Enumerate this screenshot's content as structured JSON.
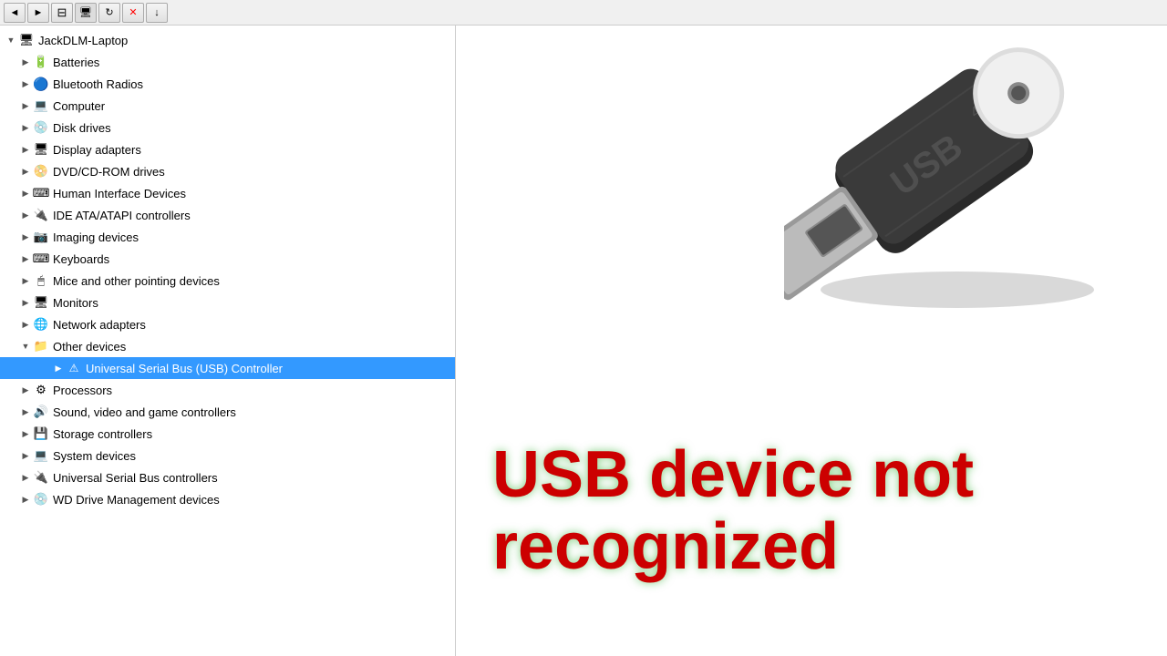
{
  "toolbar": {
    "buttons": [
      "◄",
      "►",
      "⊟",
      "⊞",
      "↑",
      "✕",
      "↓"
    ]
  },
  "tree": {
    "root": "JackDLM-Laptop",
    "items": [
      {
        "id": "batteries",
        "label": "Batteries",
        "icon": "battery",
        "indent": 1,
        "expanded": false
      },
      {
        "id": "bluetooth",
        "label": "Bluetooth Radios",
        "icon": "bluetooth",
        "indent": 1,
        "expanded": false
      },
      {
        "id": "computer",
        "label": "Computer",
        "icon": "computer",
        "indent": 1,
        "expanded": false
      },
      {
        "id": "disk",
        "label": "Disk drives",
        "icon": "disk",
        "indent": 1,
        "expanded": false
      },
      {
        "id": "display",
        "label": "Display adapters",
        "icon": "display",
        "indent": 1,
        "expanded": false
      },
      {
        "id": "dvd",
        "label": "DVD/CD-ROM drives",
        "icon": "dvd",
        "indent": 1,
        "expanded": false
      },
      {
        "id": "hid",
        "label": "Human Interface Devices",
        "icon": "hid",
        "indent": 1,
        "expanded": false
      },
      {
        "id": "ide",
        "label": "IDE ATA/ATAPI controllers",
        "icon": "ide",
        "indent": 1,
        "expanded": false
      },
      {
        "id": "imaging",
        "label": "Imaging devices",
        "icon": "imaging",
        "indent": 1,
        "expanded": false
      },
      {
        "id": "keyboards",
        "label": "Keyboards",
        "icon": "keyboard",
        "indent": 1,
        "expanded": false
      },
      {
        "id": "mice",
        "label": "Mice and other pointing devices",
        "icon": "mouse",
        "indent": 1,
        "expanded": false
      },
      {
        "id": "monitors",
        "label": "Monitors",
        "icon": "monitor",
        "indent": 1,
        "expanded": false
      },
      {
        "id": "network",
        "label": "Network adapters",
        "icon": "network",
        "indent": 1,
        "expanded": false
      },
      {
        "id": "other",
        "label": "Other devices",
        "icon": "other",
        "indent": 1,
        "expanded": true
      },
      {
        "id": "usb-ctrl",
        "label": "Universal Serial Bus (USB) Controller",
        "icon": "warning",
        "indent": 2,
        "expanded": false,
        "selected": true
      },
      {
        "id": "processors",
        "label": "Processors",
        "icon": "processor",
        "indent": 1,
        "expanded": false
      },
      {
        "id": "sound",
        "label": "Sound, video and game controllers",
        "icon": "sound",
        "indent": 1,
        "expanded": false
      },
      {
        "id": "storage",
        "label": "Storage controllers",
        "icon": "storage",
        "indent": 1,
        "expanded": false
      },
      {
        "id": "system",
        "label": "System devices",
        "icon": "system",
        "indent": 1,
        "expanded": false
      },
      {
        "id": "usb-bus",
        "label": "Universal Serial Bus controllers",
        "icon": "usb",
        "indent": 1,
        "expanded": false
      },
      {
        "id": "wd",
        "label": "WD Drive Management devices",
        "icon": "wd",
        "indent": 1,
        "expanded": false
      }
    ]
  },
  "error": {
    "title": "USB device not recognized"
  }
}
